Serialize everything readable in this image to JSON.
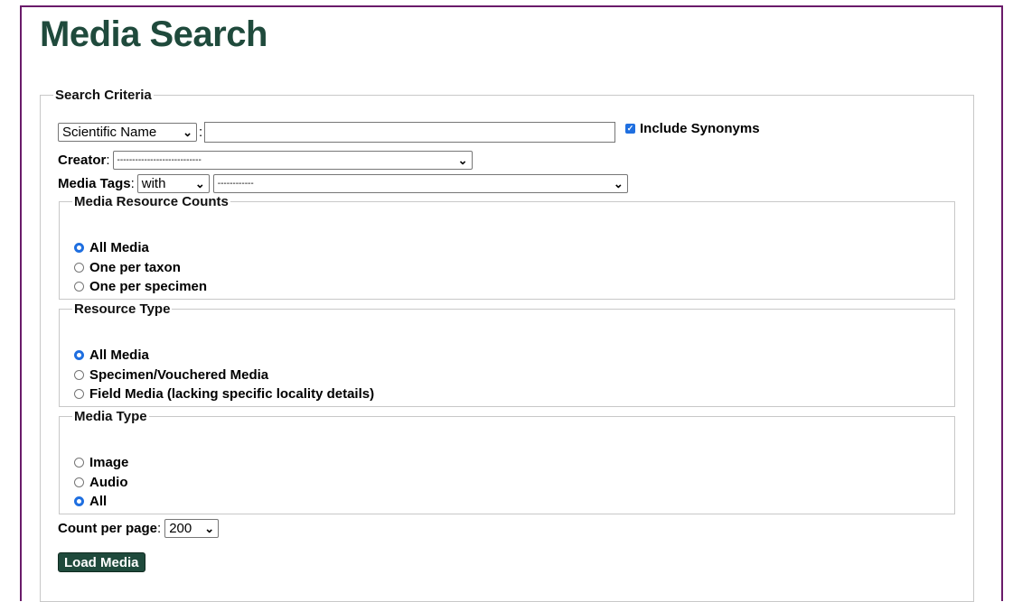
{
  "page": {
    "title": "Media Search"
  },
  "criteria": {
    "legend": "Search Criteria",
    "search_field": {
      "selected": "Scientific Name",
      "separator": ":",
      "value": ""
    },
    "include_synonyms": {
      "label": "Include Synonyms",
      "checked": true
    },
    "creator": {
      "label": "Creator",
      "selected": "----------------------------"
    },
    "media_tags": {
      "label": "Media Tags",
      "mode": "with",
      "selected": "------------"
    }
  },
  "resource_counts": {
    "legend": "Media Resource Counts",
    "options": [
      {
        "label": "All Media",
        "checked": true
      },
      {
        "label": "One per taxon",
        "checked": false
      },
      {
        "label": "One per specimen",
        "checked": false
      }
    ]
  },
  "resource_type": {
    "legend": "Resource Type",
    "options": [
      {
        "label": "All Media",
        "checked": true
      },
      {
        "label": "Specimen/Vouchered Media",
        "checked": false
      },
      {
        "label": "Field Media (lacking specific locality details)",
        "checked": false
      }
    ]
  },
  "media_type": {
    "legend": "Media Type",
    "options": [
      {
        "label": "Image",
        "checked": false
      },
      {
        "label": "Audio",
        "checked": false
      },
      {
        "label": "All",
        "checked": true
      }
    ]
  },
  "count_per_page": {
    "label": "Count per page",
    "value": "200"
  },
  "load_button": {
    "label": "Load Media"
  },
  "colors": {
    "title": "#1f4a3c",
    "button_bg": "#1f4a3c",
    "frame": "#6a1b6a",
    "accent": "#1f6fe0"
  }
}
